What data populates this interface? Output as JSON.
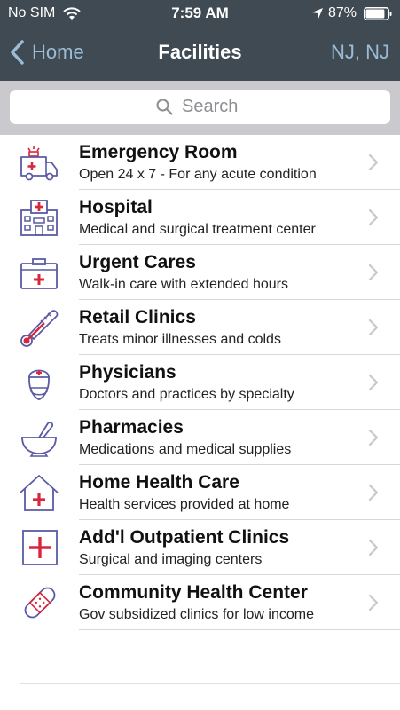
{
  "status": {
    "carrier": "No SIM",
    "time": "7:59 AM",
    "battery": "87%",
    "battery_level": 0.87
  },
  "nav": {
    "back_label": "Home",
    "title": "Facilities",
    "state": "NJ, NJ"
  },
  "search": {
    "placeholder": "Search",
    "value": ""
  },
  "colors": {
    "bar": "#3f4a52",
    "link": "#9bbcd8",
    "icon_stroke": "#5a5aa6",
    "icon_cross": "#d7263d"
  },
  "facilities": [
    {
      "title": "Emergency Room",
      "subtitle": "Open 24 x 7 - For any acute condition",
      "icon": "ambulance-icon"
    },
    {
      "title": "Hospital",
      "subtitle": "Medical and surgical treatment center",
      "icon": "hospital-icon"
    },
    {
      "title": "Urgent Cares",
      "subtitle": "Walk-in care with extended hours",
      "icon": "medical-kit-icon"
    },
    {
      "title": "Retail Clinics",
      "subtitle": "Treats minor illnesses and colds",
      "icon": "thermometer-icon"
    },
    {
      "title": "Physicians",
      "subtitle": "Doctors and practices by specialty",
      "icon": "doctor-icon"
    },
    {
      "title": "Pharmacies",
      "subtitle": "Medications and medical supplies",
      "icon": "mortar-pestle-icon"
    },
    {
      "title": "Home Health Care",
      "subtitle": "Health services provided at home",
      "icon": "home-cross-icon"
    },
    {
      "title": "Add'l Outpatient Clinics",
      "subtitle": "Surgical and imaging centers",
      "icon": "cross-box-icon"
    },
    {
      "title": "Community Health Center",
      "subtitle": "Gov subsidized clinics for low income",
      "icon": "bandage-icon"
    }
  ]
}
